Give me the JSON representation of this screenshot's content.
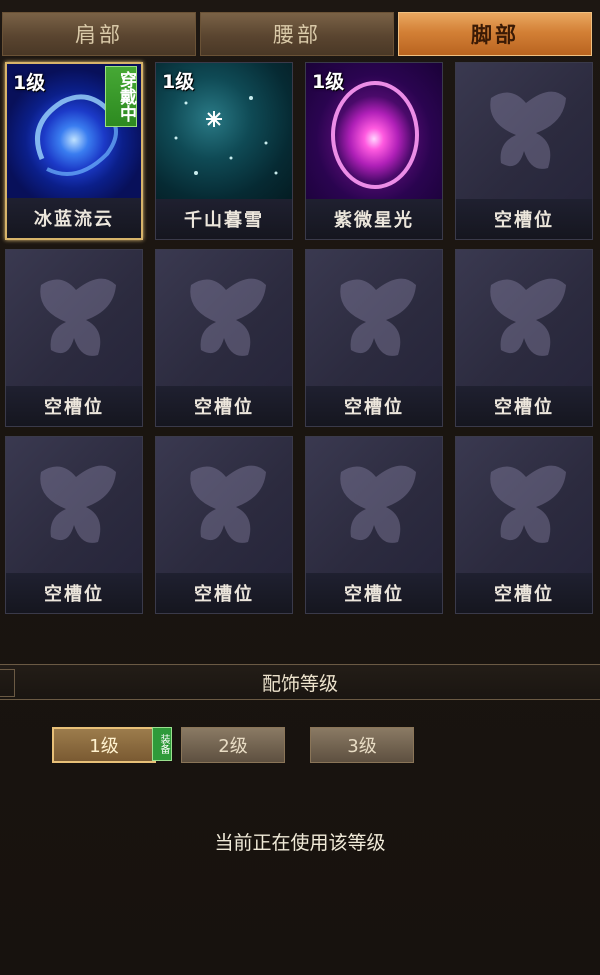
{
  "tabs": [
    {
      "label": "肩部"
    },
    {
      "label": "腰部"
    },
    {
      "label": "脚部"
    }
  ],
  "active_tab": 2,
  "slots": [
    {
      "name": "冰蓝流云",
      "level": "1级",
      "art": "ice",
      "equipped_badge": "穿戴中"
    },
    {
      "name": "千山暮雪",
      "level": "1级",
      "art": "snow"
    },
    {
      "name": "紫微星光",
      "level": "1级",
      "art": "purple"
    },
    {
      "name": "空槽位"
    },
    {
      "name": "空槽位"
    },
    {
      "name": "空槽位"
    },
    {
      "name": "空槽位"
    },
    {
      "name": "空槽位"
    },
    {
      "name": "空槽位"
    },
    {
      "name": "空槽位"
    },
    {
      "name": "空槽位"
    },
    {
      "name": "空槽位"
    }
  ],
  "section": {
    "title": "配饰等级"
  },
  "levels": [
    {
      "label": "1级",
      "badge": "装备"
    },
    {
      "label": "2级"
    },
    {
      "label": "3级"
    }
  ],
  "status_text": "当前正在使用该等级",
  "icons": {
    "empty_slot": "butterfly-icon"
  },
  "colors": {
    "active_tab": "#d38036",
    "equip_badge": "#2d8a20",
    "selected_border": "#d7b46a"
  }
}
